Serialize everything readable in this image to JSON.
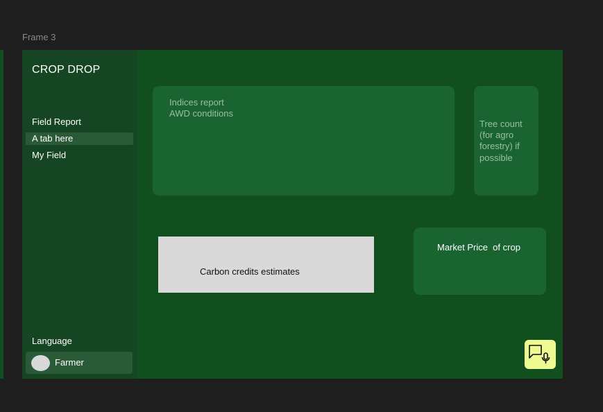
{
  "canvas": {
    "frame_label": "Frame 3"
  },
  "sidebar": {
    "brand": "CROP DROP",
    "items": [
      {
        "label": "Field Report"
      },
      {
        "label": "A tab here"
      },
      {
        "label": "My Field"
      }
    ],
    "language_label": "Language",
    "profile_name": "Farmer"
  },
  "cards": {
    "indices": {
      "line1": "Indices report",
      "line2": "AWD conditions"
    },
    "tree": {
      "text": "Tree count (for agro forestry) if possible"
    },
    "carbon": {
      "text": "Carbon credits estimates"
    },
    "market": {
      "text": "Market Price  of crop"
    }
  },
  "icons": {
    "chat": "chat-mic-icon"
  },
  "colors": {
    "frame_bg": "#114f1f",
    "sidebar_bg": "#154522",
    "card_bg": "#1a6431",
    "active_tab_bg": "#2a5a38",
    "chat_button_bg": "#eefb92",
    "carbon_box_bg": "#d9d9d9"
  }
}
